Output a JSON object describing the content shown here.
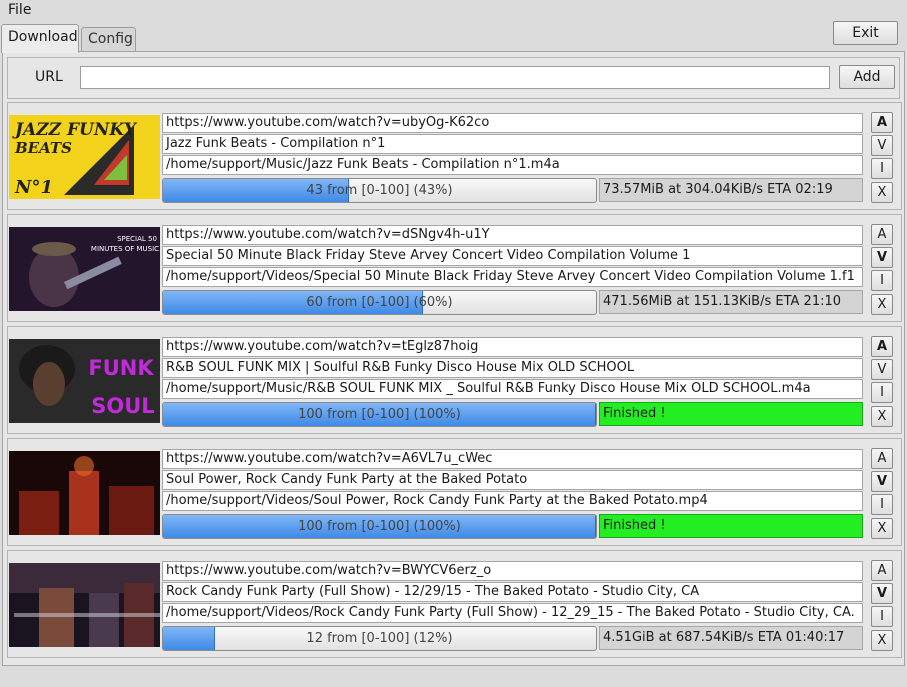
{
  "menu": {
    "file": "File"
  },
  "tabs": [
    {
      "label": "Download"
    },
    {
      "label": "Config"
    }
  ],
  "exit_label": "Exit",
  "url_bar": {
    "label": "URL",
    "value": "",
    "add_label": "Add"
  },
  "side_buttons": {
    "a": "A",
    "v": "V",
    "i": "I",
    "x": "X"
  },
  "items": [
    {
      "url": "https://www.youtube.com/watch?v=ubyOg-K62co",
      "title": "Jazz Funk Beats - Compilation n°1",
      "path": "/home/support/Music/Jazz Funk Beats - Compilation n°1.m4a",
      "progress": 43,
      "progress_text": "43 from [0-100] (43%)",
      "status": "73.57MiB at 304.04KiB/s ETA 02:19",
      "finished": false,
      "thumb": {
        "line1": "JAZZ FUNKY",
        "line2": "BEATS",
        "line3": "N°1"
      }
    },
    {
      "url": "https://www.youtube.com/watch?v=dSNgv4h-u1Y",
      "title": "Special 50 Minute Black Friday Steve Arvey Concert Video Compilation Volume 1",
      "path": "/home/support/Videos/Special 50 Minute Black Friday Steve Arvey Concert Video Compilation Volume 1.f1",
      "progress": 60,
      "progress_text": "60 from [0-100] (60%)",
      "status": "471.56MiB at 151.13KiB/s ETA 21:10",
      "finished": false,
      "thumb": {
        "line1": "SPECIAL 50",
        "line2": "MINUTES OF MUSIC",
        "line3": ""
      }
    },
    {
      "url": "https://www.youtube.com/watch?v=tEglz87hoig",
      "title": "R&B SOUL FUNK MIX |  Soulful R&B Funky Disco House Mix OLD SCHOOL",
      "path": "/home/support/Music/R&B SOUL FUNK MIX _  Soulful R&B Funky Disco House Mix OLD SCHOOL.m4a",
      "progress": 100,
      "progress_text": "100 from [0-100] (100%)",
      "status": "Finished !",
      "finished": true,
      "thumb": {
        "line1": "FUNK",
        "line2": "SOUL",
        "line3": ""
      }
    },
    {
      "url": "https://www.youtube.com/watch?v=A6VL7u_cWec",
      "title": "Soul Power, Rock Candy Funk Party at the Baked Potato",
      "path": "/home/support/Videos/Soul Power, Rock Candy Funk Party at the Baked Potato.mp4",
      "progress": 100,
      "progress_text": "100 from [0-100] (100%)",
      "status": "Finished !",
      "finished": true,
      "thumb": {
        "line1": "",
        "line2": "",
        "line3": ""
      }
    },
    {
      "url": "https://www.youtube.com/watch?v=BWYCV6erz_o",
      "title": "Rock Candy Funk Party (Full Show) - 12/29/15 - The Baked Potato - Studio City, CA",
      "path": "/home/support/Videos/Rock Candy Funk Party (Full Show) - 12_29_15 - The Baked Potato - Studio City, CA.",
      "progress": 12,
      "progress_text": "12 from [0-100] (12%)",
      "status": "4.51GiB at 687.54KiB/s ETA 01:40:17",
      "finished": false,
      "thumb": {
        "line1": "",
        "line2": "",
        "line3": ""
      }
    }
  ],
  "colors": {
    "progress_fill": "#4a90e2",
    "finished": "#22ee22",
    "background": "#dcdcdc"
  }
}
